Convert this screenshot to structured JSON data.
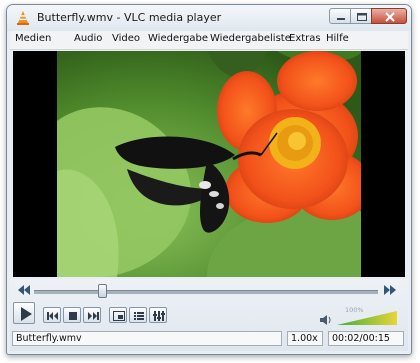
{
  "window": {
    "title": "Butterfly.wmv - VLC media player"
  },
  "menu": [
    {
      "label": "Medien"
    },
    {
      "label": "Audio"
    },
    {
      "label": "Video"
    },
    {
      "label": "Wiedergabe"
    },
    {
      "label": "Wiedergabeliste"
    },
    {
      "label": "Extras"
    },
    {
      "label": "Hilfe"
    }
  ],
  "player": {
    "progress": 0.2,
    "volume_label": "100%",
    "volume": 1.0
  },
  "status": {
    "filename": "Butterfly.wmv",
    "speed": "1.00x",
    "time": "00:02/00:15"
  },
  "colors": {
    "accent": "#2f6fb7",
    "volume_low": "#3fae3a",
    "volume_high": "#e8d43a"
  }
}
